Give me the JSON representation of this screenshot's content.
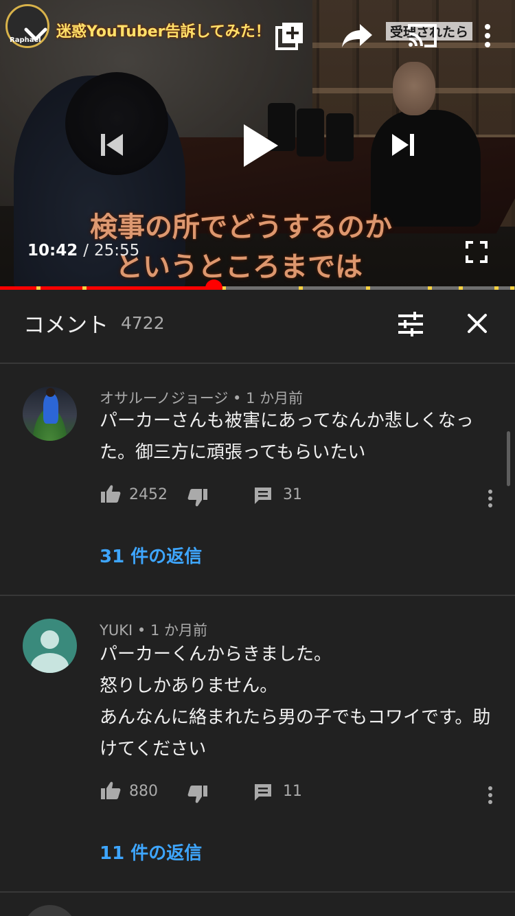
{
  "player": {
    "video_title_overlay": "迷惑YouTuber告訴してみた！",
    "channel_logo_text": "Raphael",
    "corner_overlay_text": "受理されたら",
    "subtitle_line1": "検事の所でどうするのか",
    "subtitle_line2": "というところまでは",
    "current_time": "10:42",
    "time_separator": "/",
    "duration": "25:55",
    "progress_fraction": 0.415,
    "chapter_markers": [
      0.07,
      0.16,
      0.43,
      0.58,
      0.71,
      0.83,
      0.89,
      0.96,
      0.99
    ],
    "colors": {
      "progress": "#ff0000",
      "marker": "#f6d142",
      "track": "#6f6f6f"
    },
    "icons": {
      "collapse": "chevron-down-icon",
      "add_to_playlist": "add-to-queue-icon",
      "share": "share-icon",
      "cast": "cast-icon",
      "more": "more-vertical-icon",
      "previous": "skip-previous-icon",
      "play": "play-icon",
      "next": "skip-next-icon",
      "fullscreen": "fullscreen-icon"
    }
  },
  "comments_panel": {
    "title": "コメント",
    "count": "4722",
    "icons": {
      "filter": "sort-filter-icon",
      "close": "close-icon"
    },
    "accent_color": "#3ea6ff",
    "comments": [
      {
        "author": "オサルーノジョージ",
        "separator": "•",
        "time": "1 か月前",
        "avatar": "avatar-photo",
        "text": "パーカーさんも被害にあってなんか悲しくなった。御三方に頑張ってもらいたい",
        "likes": "2452",
        "reply_count": "31",
        "replies_label": "31 件の返信"
      },
      {
        "author": "YUKI",
        "separator": "•",
        "time": "1 か月前",
        "avatar": "avatar-default",
        "text": "パーカーくんからきました。\n怒りしかありません。\nあんなんに絡まれたら男の子でもコワイです。助けてください",
        "likes": "880",
        "reply_count": "11",
        "replies_label": "11 件の返信"
      }
    ]
  }
}
